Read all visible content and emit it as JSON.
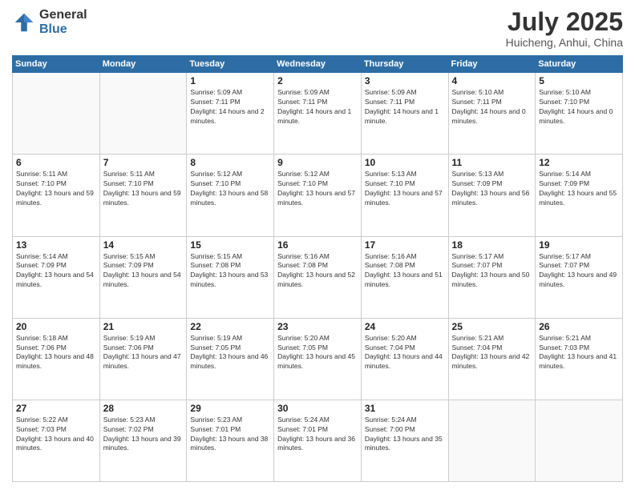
{
  "logo": {
    "general": "General",
    "blue": "Blue"
  },
  "title": {
    "month_year": "July 2025",
    "location": "Huicheng, Anhui, China"
  },
  "weekdays": [
    "Sunday",
    "Monday",
    "Tuesday",
    "Wednesday",
    "Thursday",
    "Friday",
    "Saturday"
  ],
  "weeks": [
    [
      {
        "day": "",
        "sunrise": "",
        "sunset": "",
        "daylight": ""
      },
      {
        "day": "",
        "sunrise": "",
        "sunset": "",
        "daylight": ""
      },
      {
        "day": "1",
        "sunrise": "Sunrise: 5:09 AM",
        "sunset": "Sunset: 7:11 PM",
        "daylight": "Daylight: 14 hours and 2 minutes."
      },
      {
        "day": "2",
        "sunrise": "Sunrise: 5:09 AM",
        "sunset": "Sunset: 7:11 PM",
        "daylight": "Daylight: 14 hours and 1 minute."
      },
      {
        "day": "3",
        "sunrise": "Sunrise: 5:09 AM",
        "sunset": "Sunset: 7:11 PM",
        "daylight": "Daylight: 14 hours and 1 minute."
      },
      {
        "day": "4",
        "sunrise": "Sunrise: 5:10 AM",
        "sunset": "Sunset: 7:11 PM",
        "daylight": "Daylight: 14 hours and 0 minutes."
      },
      {
        "day": "5",
        "sunrise": "Sunrise: 5:10 AM",
        "sunset": "Sunset: 7:10 PM",
        "daylight": "Daylight: 14 hours and 0 minutes."
      }
    ],
    [
      {
        "day": "6",
        "sunrise": "Sunrise: 5:11 AM",
        "sunset": "Sunset: 7:10 PM",
        "daylight": "Daylight: 13 hours and 59 minutes."
      },
      {
        "day": "7",
        "sunrise": "Sunrise: 5:11 AM",
        "sunset": "Sunset: 7:10 PM",
        "daylight": "Daylight: 13 hours and 59 minutes."
      },
      {
        "day": "8",
        "sunrise": "Sunrise: 5:12 AM",
        "sunset": "Sunset: 7:10 PM",
        "daylight": "Daylight: 13 hours and 58 minutes."
      },
      {
        "day": "9",
        "sunrise": "Sunrise: 5:12 AM",
        "sunset": "Sunset: 7:10 PM",
        "daylight": "Daylight: 13 hours and 57 minutes."
      },
      {
        "day": "10",
        "sunrise": "Sunrise: 5:13 AM",
        "sunset": "Sunset: 7:10 PM",
        "daylight": "Daylight: 13 hours and 57 minutes."
      },
      {
        "day": "11",
        "sunrise": "Sunrise: 5:13 AM",
        "sunset": "Sunset: 7:09 PM",
        "daylight": "Daylight: 13 hours and 56 minutes."
      },
      {
        "day": "12",
        "sunrise": "Sunrise: 5:14 AM",
        "sunset": "Sunset: 7:09 PM",
        "daylight": "Daylight: 13 hours and 55 minutes."
      }
    ],
    [
      {
        "day": "13",
        "sunrise": "Sunrise: 5:14 AM",
        "sunset": "Sunset: 7:09 PM",
        "daylight": "Daylight: 13 hours and 54 minutes."
      },
      {
        "day": "14",
        "sunrise": "Sunrise: 5:15 AM",
        "sunset": "Sunset: 7:09 PM",
        "daylight": "Daylight: 13 hours and 54 minutes."
      },
      {
        "day": "15",
        "sunrise": "Sunrise: 5:15 AM",
        "sunset": "Sunset: 7:08 PM",
        "daylight": "Daylight: 13 hours and 53 minutes."
      },
      {
        "day": "16",
        "sunrise": "Sunrise: 5:16 AM",
        "sunset": "Sunset: 7:08 PM",
        "daylight": "Daylight: 13 hours and 52 minutes."
      },
      {
        "day": "17",
        "sunrise": "Sunrise: 5:16 AM",
        "sunset": "Sunset: 7:08 PM",
        "daylight": "Daylight: 13 hours and 51 minutes."
      },
      {
        "day": "18",
        "sunrise": "Sunrise: 5:17 AM",
        "sunset": "Sunset: 7:07 PM",
        "daylight": "Daylight: 13 hours and 50 minutes."
      },
      {
        "day": "19",
        "sunrise": "Sunrise: 5:17 AM",
        "sunset": "Sunset: 7:07 PM",
        "daylight": "Daylight: 13 hours and 49 minutes."
      }
    ],
    [
      {
        "day": "20",
        "sunrise": "Sunrise: 5:18 AM",
        "sunset": "Sunset: 7:06 PM",
        "daylight": "Daylight: 13 hours and 48 minutes."
      },
      {
        "day": "21",
        "sunrise": "Sunrise: 5:19 AM",
        "sunset": "Sunset: 7:06 PM",
        "daylight": "Daylight: 13 hours and 47 minutes."
      },
      {
        "day": "22",
        "sunrise": "Sunrise: 5:19 AM",
        "sunset": "Sunset: 7:05 PM",
        "daylight": "Daylight: 13 hours and 46 minutes."
      },
      {
        "day": "23",
        "sunrise": "Sunrise: 5:20 AM",
        "sunset": "Sunset: 7:05 PM",
        "daylight": "Daylight: 13 hours and 45 minutes."
      },
      {
        "day": "24",
        "sunrise": "Sunrise: 5:20 AM",
        "sunset": "Sunset: 7:04 PM",
        "daylight": "Daylight: 13 hours and 44 minutes."
      },
      {
        "day": "25",
        "sunrise": "Sunrise: 5:21 AM",
        "sunset": "Sunset: 7:04 PM",
        "daylight": "Daylight: 13 hours and 42 minutes."
      },
      {
        "day": "26",
        "sunrise": "Sunrise: 5:21 AM",
        "sunset": "Sunset: 7:03 PM",
        "daylight": "Daylight: 13 hours and 41 minutes."
      }
    ],
    [
      {
        "day": "27",
        "sunrise": "Sunrise: 5:22 AM",
        "sunset": "Sunset: 7:03 PM",
        "daylight": "Daylight: 13 hours and 40 minutes."
      },
      {
        "day": "28",
        "sunrise": "Sunrise: 5:23 AM",
        "sunset": "Sunset: 7:02 PM",
        "daylight": "Daylight: 13 hours and 39 minutes."
      },
      {
        "day": "29",
        "sunrise": "Sunrise: 5:23 AM",
        "sunset": "Sunset: 7:01 PM",
        "daylight": "Daylight: 13 hours and 38 minutes."
      },
      {
        "day": "30",
        "sunrise": "Sunrise: 5:24 AM",
        "sunset": "Sunset: 7:01 PM",
        "daylight": "Daylight: 13 hours and 36 minutes."
      },
      {
        "day": "31",
        "sunrise": "Sunrise: 5:24 AM",
        "sunset": "Sunset: 7:00 PM",
        "daylight": "Daylight: 13 hours and 35 minutes."
      },
      {
        "day": "",
        "sunrise": "",
        "sunset": "",
        "daylight": ""
      },
      {
        "day": "",
        "sunrise": "",
        "sunset": "",
        "daylight": ""
      }
    ]
  ]
}
